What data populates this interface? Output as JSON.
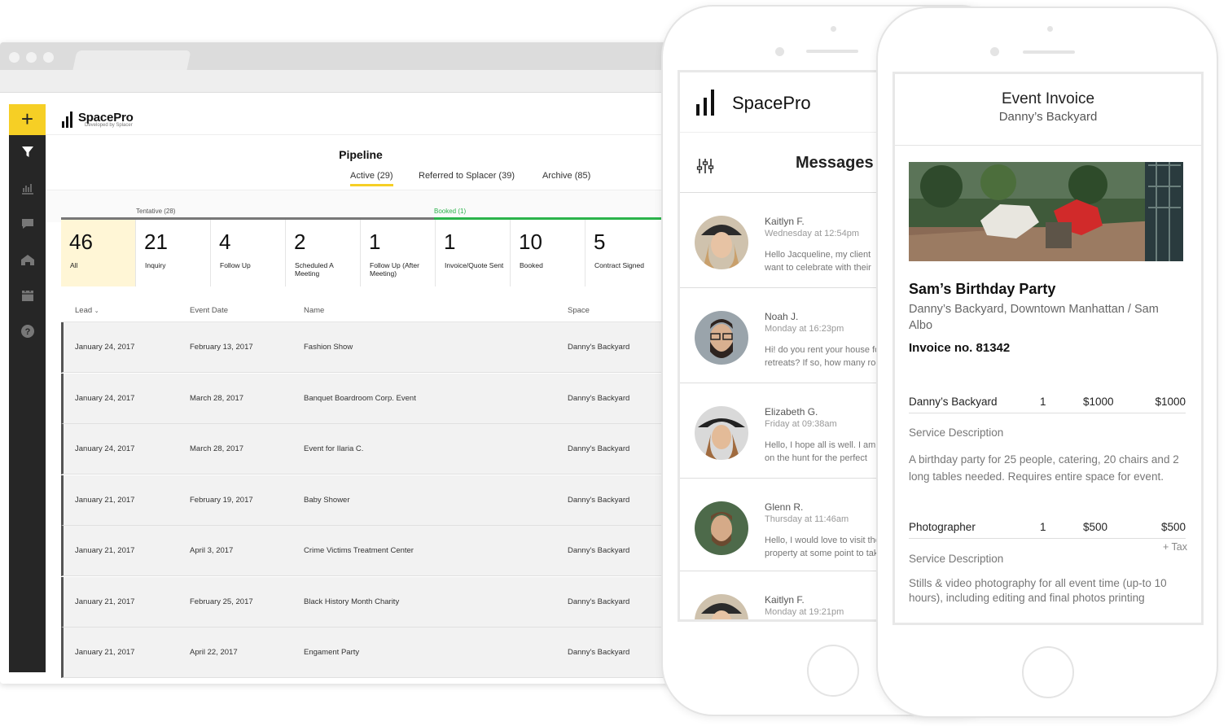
{
  "colors": {
    "accent": "#f6cf25",
    "booked": "#2bb34b",
    "sidebar": "#262626"
  },
  "desktop": {
    "brand": "SpacePro",
    "brand_sub": "Developed by Splacer",
    "title": "Pipeline",
    "tabs": [
      "Active (29)",
      "Referred to Splacer (39)",
      "Archive (85)"
    ],
    "stages": {
      "tentative": "Tentative (28)",
      "booked": "Booked (1)"
    },
    "counts": [
      {
        "num": "46",
        "label": "All"
      },
      {
        "num": "21",
        "label": "Inquiry"
      },
      {
        "num": "4",
        "label": "Follow Up"
      },
      {
        "num": "2",
        "label": "Scheduled A Meeting"
      },
      {
        "num": "1",
        "label": "Follow Up (After Meeting)"
      },
      {
        "num": "1",
        "label": "Invoice/Quote Sent"
      },
      {
        "num": "10",
        "label": "Booked"
      },
      {
        "num": "5",
        "label": "Contract Signed"
      }
    ],
    "columns": {
      "lead": "Lead",
      "event_date": "Event Date",
      "name": "Name",
      "space": "Space"
    },
    "rows": [
      {
        "lead": "January 24, 2017",
        "date": "February 13, 2017",
        "name": "Fashion Show",
        "space": "Danny's Backyard"
      },
      {
        "lead": "January 24, 2017",
        "date": "March 28, 2017",
        "name": "Banquet Boardroom Corp. Event",
        "space": "Danny's Backyard"
      },
      {
        "lead": "January 24, 2017",
        "date": "March 28, 2017",
        "name": "Event for Ilaria C.",
        "space": "Danny's Backyard"
      },
      {
        "lead": "January 21, 2017",
        "date": "February 19, 2017",
        "name": "Baby Shower",
        "space": "Danny's Backyard"
      },
      {
        "lead": "January 21, 2017",
        "date": "April 3, 2017",
        "name": "Crime Victims Treatment Center",
        "space": "Danny's Backyard"
      },
      {
        "lead": "January 21, 2017",
        "date": "February 25, 2017",
        "name": "Black History Month Charity",
        "space": "Danny's Backyard"
      },
      {
        "lead": "January 21, 2017",
        "date": "April 22, 2017",
        "name": "Engament Party",
        "space": "Danny's Backyard"
      }
    ]
  },
  "messages_phone": {
    "brand": "SpacePro",
    "title": "Messages",
    "messages": [
      {
        "name": "Kaitlyn F.",
        "time": "Wednesday at 12:54pm",
        "text1": "Hello Jacqueline, my client",
        "text2": "want to celebrate with their"
      },
      {
        "name": "Noah J.",
        "time": "Monday at 16:23pm",
        "text1": "Hi! do you rent your house for",
        "text2": "retreats? If so, how many rooms"
      },
      {
        "name": "Elizabeth G.",
        "time": "Friday at 09:38am",
        "text1": "Hello, I hope all is well. I am",
        "text2": "on the hunt for the perfect"
      },
      {
        "name": "Glenn R.",
        "time": "Thursday at 11:46am",
        "text1": "Hello, I would love to visit the",
        "text2": "property at some point to take"
      },
      {
        "name": "Kaitlyn F.",
        "time": "Monday at 19:21pm",
        "text1": "",
        "text2": ""
      }
    ]
  },
  "invoice_phone": {
    "title": "Event Invoice",
    "subtitle": "Danny’s Backyard",
    "event": "Sam’s Birthday Party",
    "location": "Danny’s Backyard, Downtown Manhattan  /  Sam Albo",
    "invoice_no": "Invoice no. 81342",
    "items": [
      {
        "name": "Danny’s Backyard",
        "qty": "1",
        "price": "$1000",
        "total": "$1000",
        "service_label": "Service Description",
        "desc": "A birthday party for 25 people, catering, 20 chairs and 2 long tables needed. Requires entire space for event."
      },
      {
        "name": "Photographer",
        "qty": "1",
        "price": "$500",
        "total": "$500",
        "tax": "+ Tax",
        "service_label": "Service Description",
        "desc": "Stills & video photography for all event time (up-to 10 hours), including editing and final photos printing"
      }
    ]
  }
}
